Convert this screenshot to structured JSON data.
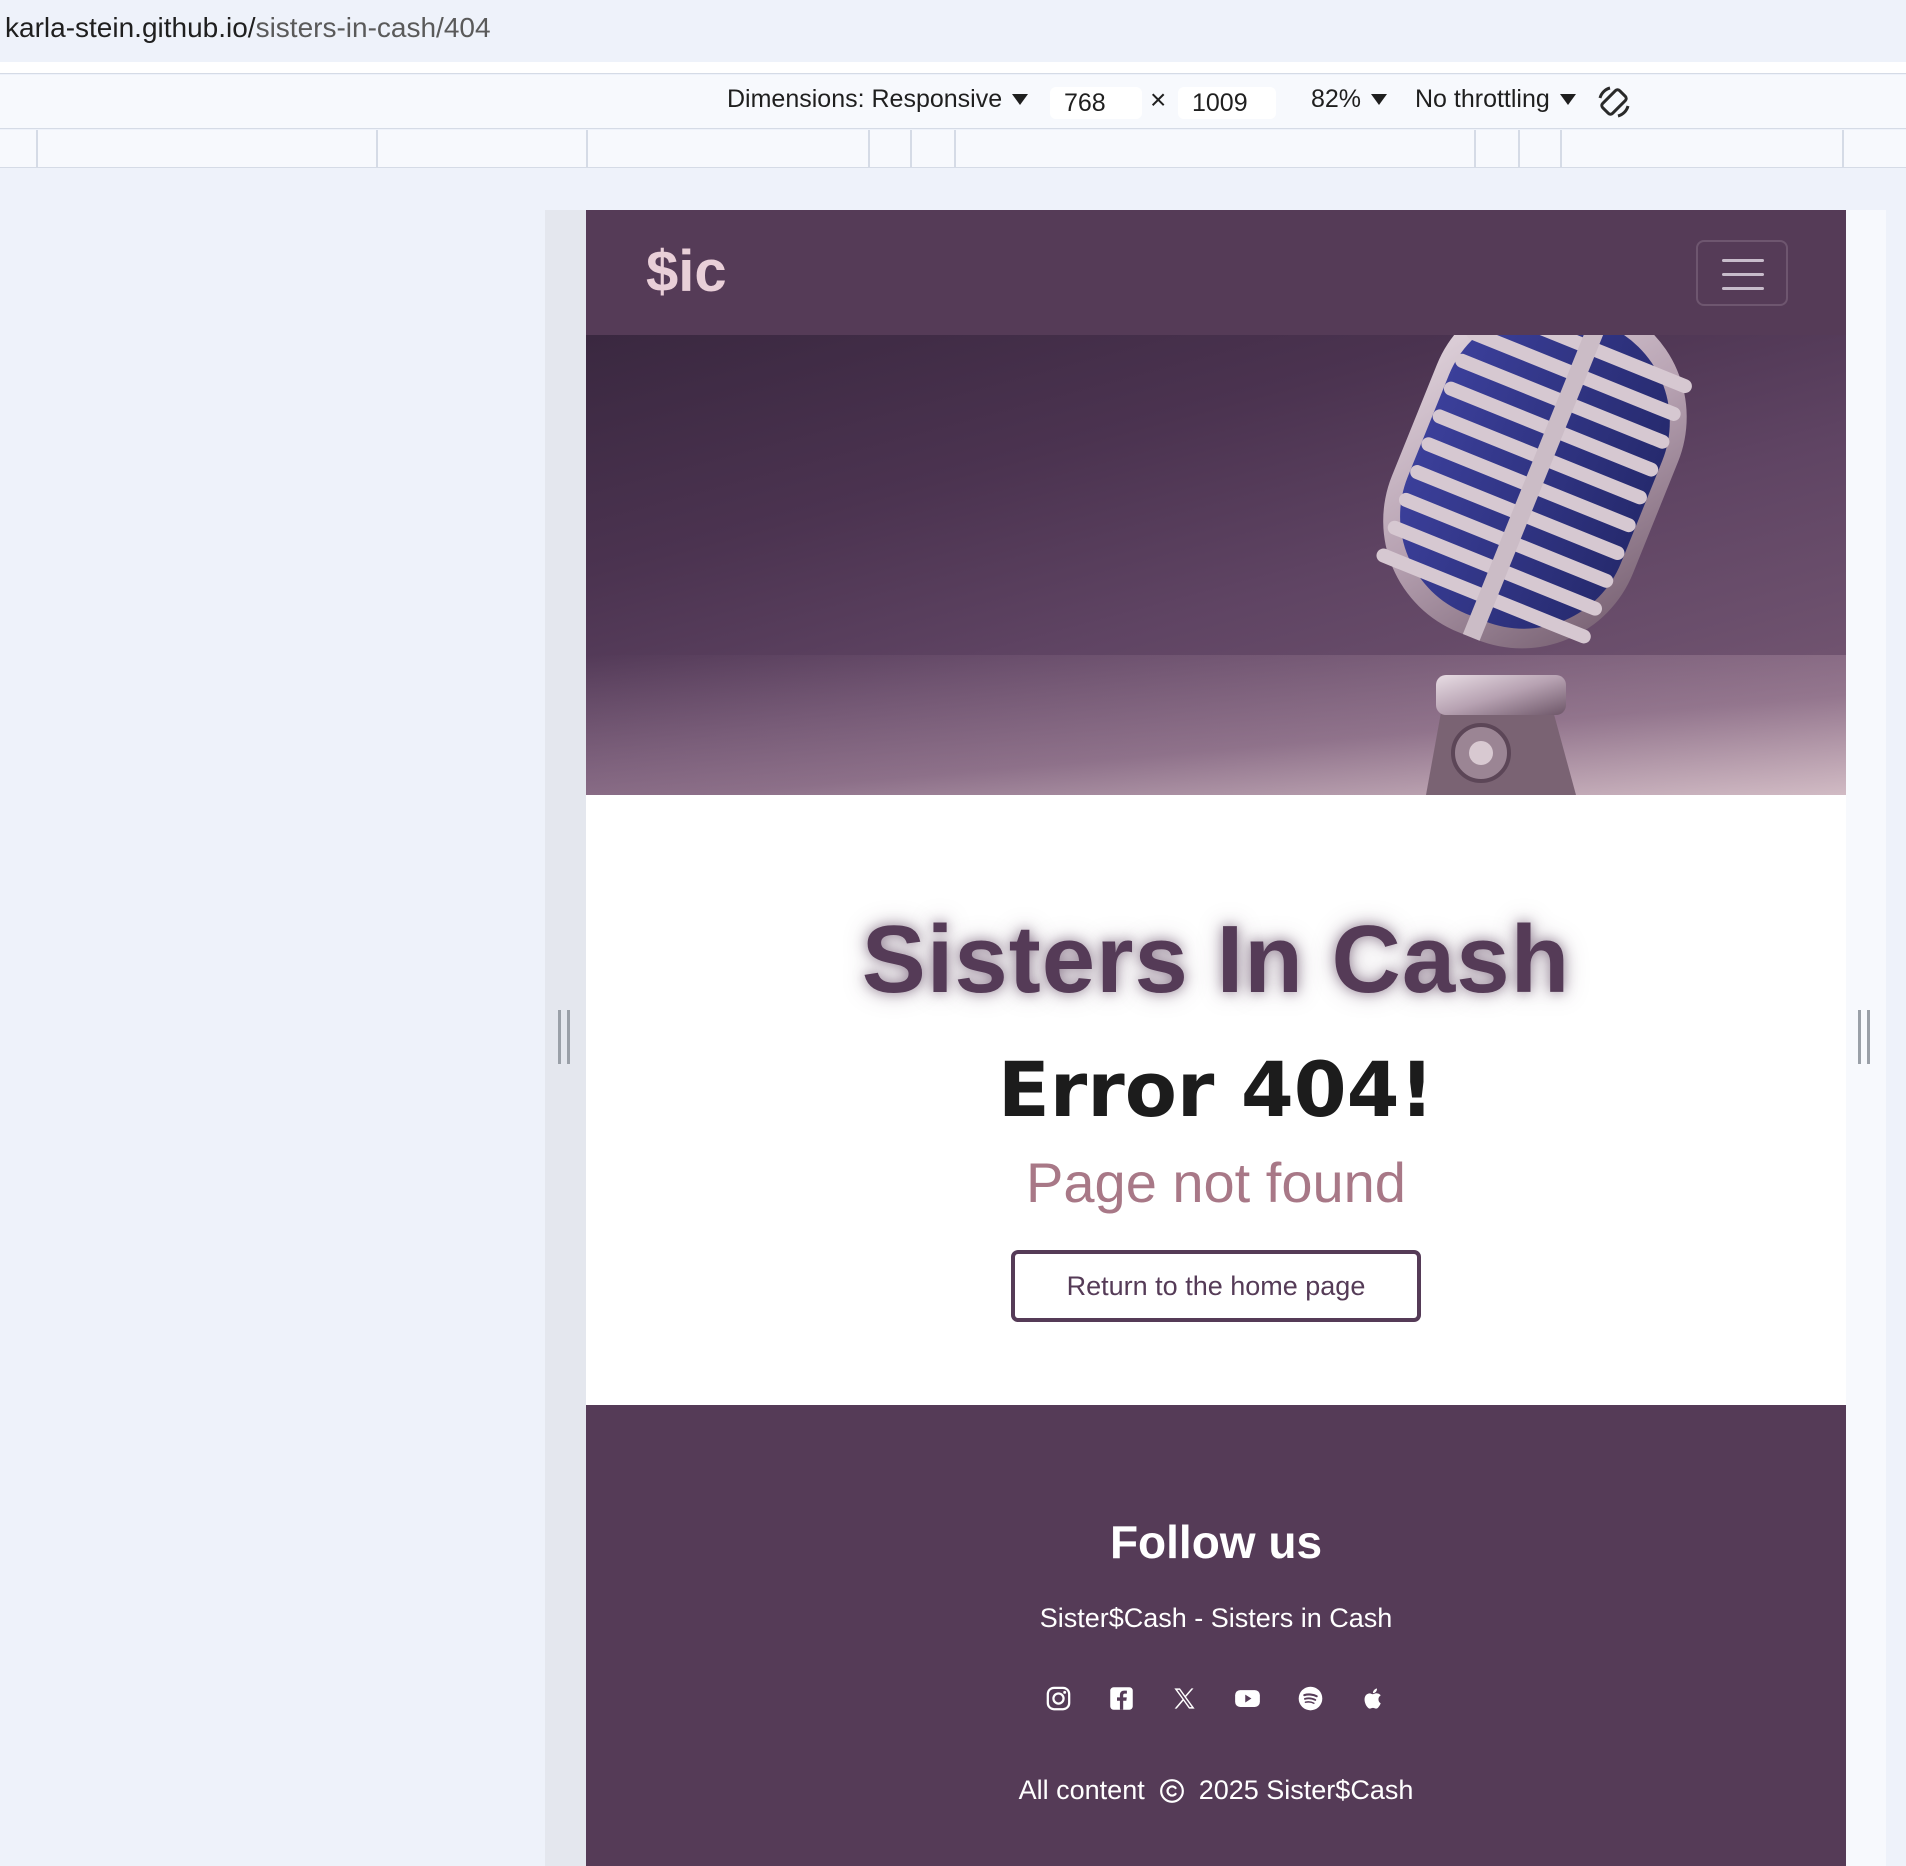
{
  "browser": {
    "url_host": "karla-stein.github.io/",
    "url_path": "sisters-in-cash/404"
  },
  "devtools": {
    "dimensions_label": "Dimensions: Responsive",
    "width_value": "768",
    "height_value": "1009",
    "times": "×",
    "zoom": "82%",
    "throttling": "No throttling",
    "rotate_icon": "rotate-icon"
  },
  "page": {
    "navbar": {
      "brand": "$ic",
      "toggler_icon": "hamburger-menu-icon"
    },
    "hero": {
      "image": "microphone-hero-image"
    },
    "main": {
      "site_title": "Sisters In Cash",
      "error_heading": "Error 404!",
      "error_sub": "Page not found",
      "home_button": "Return to the home page"
    },
    "footer": {
      "heading": "Follow us",
      "tagline": "Sister$Cash - Sisters in Cash",
      "social_icons": [
        "instagram-icon",
        "facebook-icon",
        "x-icon",
        "youtube-icon",
        "spotify-icon",
        "apple-icon"
      ],
      "copyright_prefix": "All content",
      "copyright_suffix": "2025 Sister$Cash"
    },
    "colors": {
      "brand_purple": "#553b57",
      "accent_rose": "#a87887",
      "brand_pink": "#e9cfd8"
    }
  }
}
